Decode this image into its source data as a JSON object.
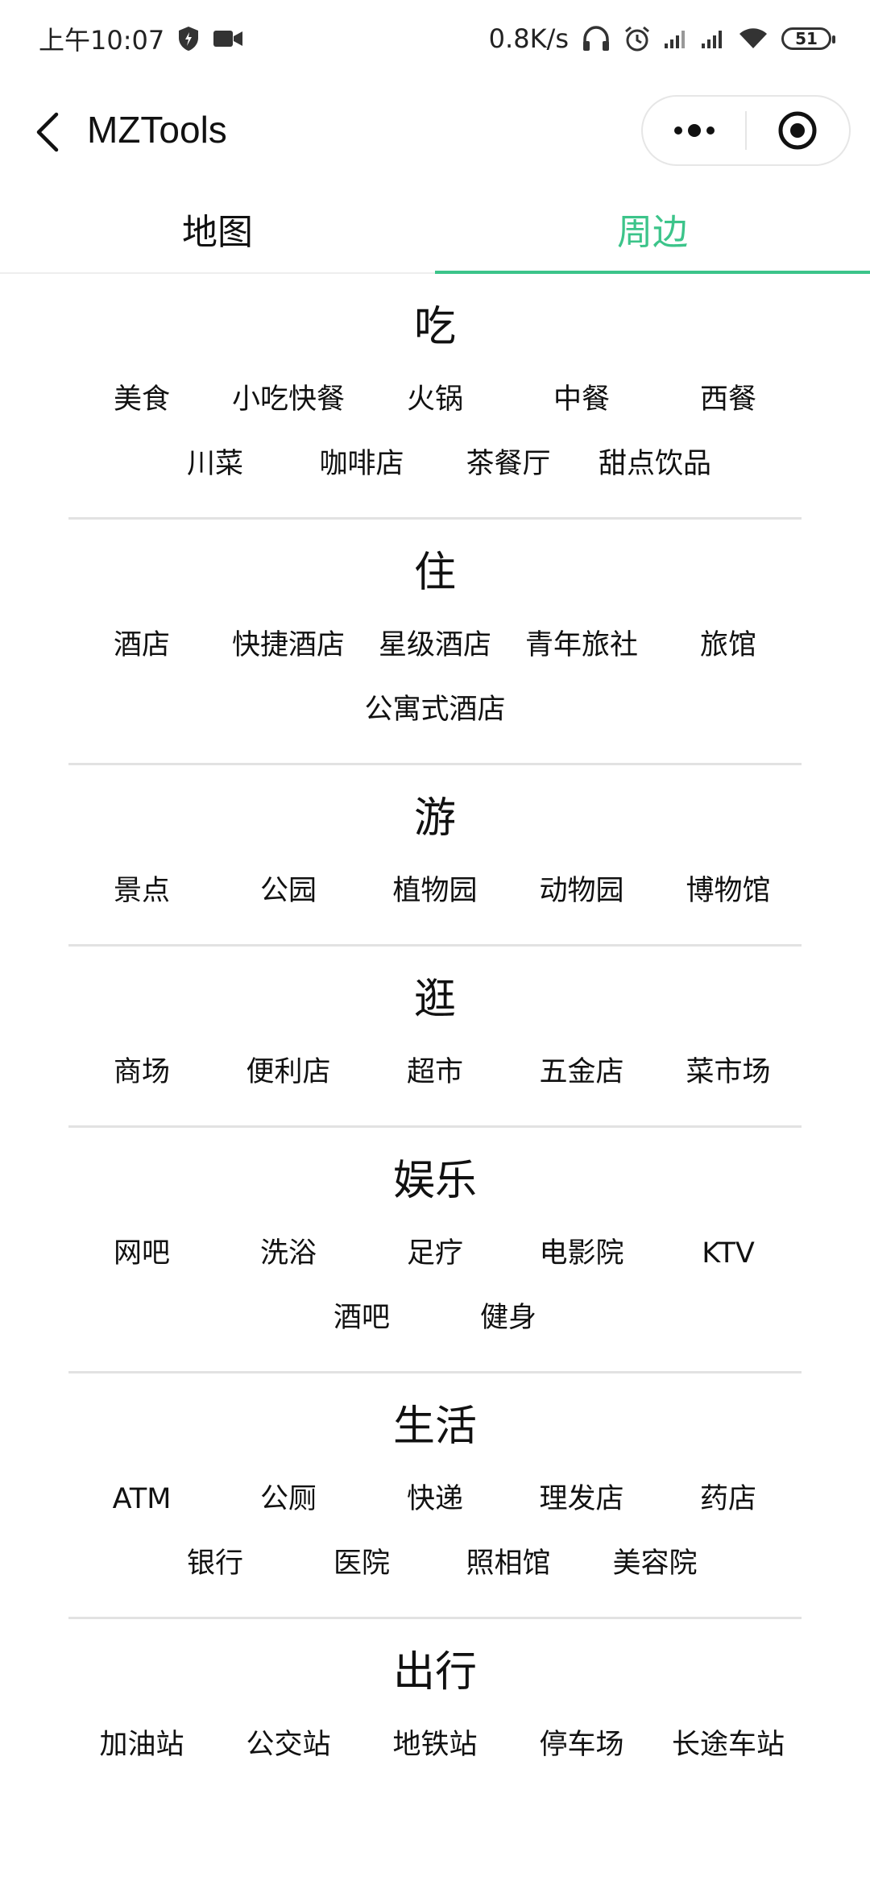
{
  "status_bar": {
    "time": "上午10:07",
    "net_speed": "0.8K/s",
    "battery": "51"
  },
  "nav": {
    "title": "MZTools"
  },
  "tabs": [
    {
      "label": "地图",
      "active": false
    },
    {
      "label": "周边",
      "active": true
    }
  ],
  "accent_color": "#3cc48a",
  "sections": [
    {
      "title": "吃",
      "items": [
        "美食",
        "小吃快餐",
        "火锅",
        "中餐",
        "西餐",
        "川菜",
        "咖啡店",
        "茶餐厅",
        "甜点饮品"
      ]
    },
    {
      "title": "住",
      "items": [
        "酒店",
        "快捷酒店",
        "星级酒店",
        "青年旅社",
        "旅馆",
        "公寓式酒店"
      ]
    },
    {
      "title": "游",
      "items": [
        "景点",
        "公园",
        "植物园",
        "动物园",
        "博物馆"
      ]
    },
    {
      "title": "逛",
      "items": [
        "商场",
        "便利店",
        "超市",
        "五金店",
        "菜市场"
      ]
    },
    {
      "title": "娱乐",
      "items": [
        "网吧",
        "洗浴",
        "足疗",
        "电影院",
        "KTV",
        "酒吧",
        "健身"
      ]
    },
    {
      "title": "生活",
      "items": [
        "ATM",
        "公厕",
        "快递",
        "理发店",
        "药店",
        "银行",
        "医院",
        "照相馆",
        "美容院"
      ]
    },
    {
      "title": "出行",
      "items": [
        "加油站",
        "公交站",
        "地铁站",
        "停车场",
        "长途车站"
      ]
    }
  ]
}
